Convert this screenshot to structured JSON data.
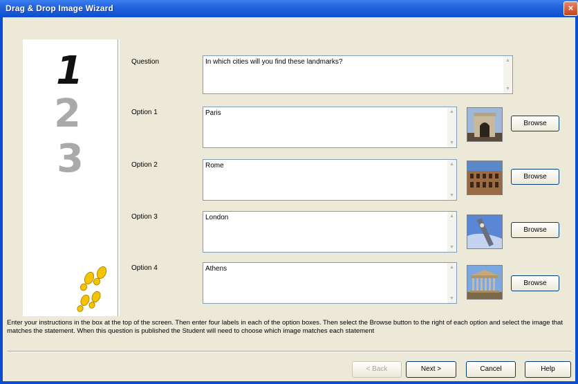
{
  "window": {
    "title": "Drag & Drop Image Wizard",
    "close_glyph": "×"
  },
  "steps": [
    "1",
    "2",
    "3"
  ],
  "question": {
    "label": "Question",
    "value": "In which cities will you find these landmarks?"
  },
  "options": [
    {
      "label": "Option 1",
      "value": "Paris",
      "browse_label": "Browse",
      "image": "arc-de-triomphe"
    },
    {
      "label": "Option 2",
      "value": "Rome",
      "browse_label": "Browse",
      "image": "colosseum"
    },
    {
      "label": "Option 3",
      "value": "London",
      "browse_label": "Browse",
      "image": "big-ben"
    },
    {
      "label": "Option 4",
      "value": "Athens",
      "browse_label": "Browse",
      "image": "parthenon"
    }
  ],
  "instructions": "Enter your instructions in the box at the top of the screen. Then enter four labels in each of the option boxes. Then select the Browse button to the right of each option and select the image that matches the statement. When this question is published the Student will need to choose which image matches each statement",
  "footer": {
    "back_label": "< Back",
    "next_label": "Next >",
    "cancel_label": "Cancel",
    "help_label": "Help"
  },
  "colors": {
    "titlebar": "#0a4fd0",
    "dialog_bg": "#ece9d8",
    "footprint": "#f5c400"
  }
}
